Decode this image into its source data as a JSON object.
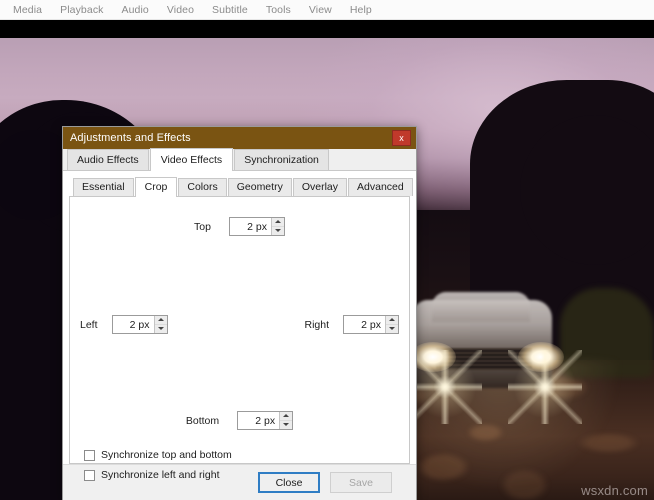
{
  "app": {
    "menubar": [
      {
        "label": "Media"
      },
      {
        "label": "Playback"
      },
      {
        "label": "Audio"
      },
      {
        "label": "Video"
      },
      {
        "label": "Subtitle"
      },
      {
        "label": "Tools"
      },
      {
        "label": "View"
      },
      {
        "label": "Help"
      }
    ],
    "watermark": "wsxdn.com"
  },
  "dialog": {
    "title": "Adjustments and Effects",
    "close_glyph": "x",
    "outer_tabs": [
      {
        "label": "Audio Effects",
        "active": false
      },
      {
        "label": "Video Effects",
        "active": true
      },
      {
        "label": "Synchronization",
        "active": false
      }
    ],
    "inner_tabs": [
      {
        "label": "Essential",
        "active": false
      },
      {
        "label": "Crop",
        "active": true
      },
      {
        "label": "Colors",
        "active": false
      },
      {
        "label": "Geometry",
        "active": false
      },
      {
        "label": "Overlay",
        "active": false
      },
      {
        "label": "Advanced",
        "active": false
      }
    ],
    "crop": {
      "top": {
        "label": "Top",
        "value": "2 px"
      },
      "left": {
        "label": "Left",
        "value": "2 px"
      },
      "right": {
        "label": "Right",
        "value": "2 px"
      },
      "bottom": {
        "label": "Bottom",
        "value": "2 px"
      },
      "sync_top_bottom": {
        "label": "Synchronize top and bottom",
        "checked": false
      },
      "sync_left_right": {
        "label": "Synchronize left and right",
        "checked": false
      }
    },
    "footer": {
      "close_label": "Close",
      "save_label": "Save",
      "save_disabled": true
    },
    "colors": {
      "titlebar": "#7a5412",
      "close_button": "#c0392b",
      "focus_ring": "#2f7dc4",
      "panel": "#f0f0f0"
    }
  }
}
